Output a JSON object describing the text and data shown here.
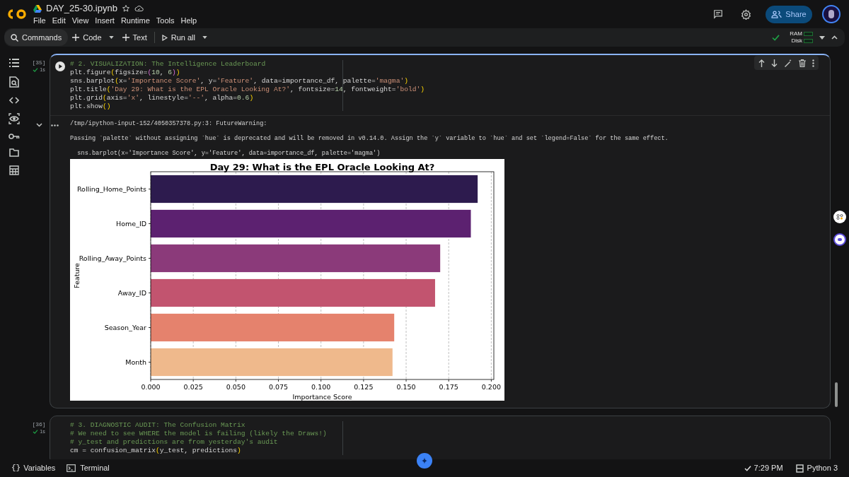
{
  "header": {
    "title": "DAY_25-30.ipynb",
    "menu": [
      "File",
      "Edit",
      "View",
      "Insert",
      "Runtime",
      "Tools",
      "Help"
    ],
    "share": "Share"
  },
  "toolbar": {
    "items": [
      {
        "kind": "search",
        "label": "Commands"
      },
      {
        "kind": "add",
        "label": "Code",
        "caret": true
      },
      {
        "kind": "add",
        "label": "Text",
        "caret": false
      },
      {
        "kind": "run",
        "label": "Run all",
        "caret": true
      }
    ],
    "ram": "RAM",
    "disk": "Disk"
  },
  "cells": [
    {
      "exec_count": "[35]",
      "duration": "1s",
      "focused": true,
      "code": [
        "# 2. VISUALIZATION: The Intelligence Leaderboard",
        "plt.figure(figsize=(10, 6))",
        "sns.barplot(x='Importance Score', y='Feature', data=importance_df, palette='magma')",
        "plt.title('Day 29: What is the EPL Oracle Looking At?', fontsize=14, fontweight='bold')",
        "plt.grid(axis='x', linestyle='--', alpha=0.6)",
        "plt.show()"
      ],
      "output": {
        "warning_path": "/tmp/ipython-input-152/4050357378.py:3: FutureWarning:",
        "warning": "Passing `palette` without assigning `hue` is deprecated and will be removed in v0.14.0. Assign the `y` variable to `hue` and set `legend=False` for the same effect.",
        "source_line": "  sns.barplot(x='Importance Score', y='Feature', data=importance_df, palette='magma')",
        "chart_data": {
          "type": "bar",
          "orientation": "horizontal",
          "title": "Day 29: What is the EPL Oracle Looking At?",
          "xlabel": "Importance Score",
          "ylabel": "Feature",
          "categories": [
            "Rolling_Home_Points",
            "Home_ID",
            "Rolling_Away_Points",
            "Away_ID",
            "Season_Year",
            "Month"
          ],
          "grid": true,
          "series": [
            {
              "colors": [
                "#2d1b4e",
                "#5c2170",
                "#8b3a7a",
                "#c2546f",
                "#e5826d",
                "#efb98c"
              ],
              "values": [
                0.192,
                0.188,
                0.17,
                0.167,
                0.143,
                0.142
              ]
            }
          ],
          "xlim": [
            0,
            0.2015
          ],
          "xticks": [
            {
              "value": 0,
              "label": "0.000"
            },
            {
              "value": 0.025,
              "label": "0.025"
            },
            {
              "value": 0.05,
              "label": "0.050"
            },
            {
              "value": 0.075,
              "label": "0.075"
            },
            {
              "value": 0.1,
              "label": "0.100"
            },
            {
              "value": 0.125,
              "label": "0.125"
            },
            {
              "value": 0.15,
              "label": "0.150"
            },
            {
              "value": 0.175,
              "label": "0.175"
            },
            {
              "value": 0.2,
              "label": "0.200"
            }
          ]
        }
      }
    },
    {
      "exec_count": "[36]",
      "duration": "1s",
      "focused": false,
      "code": [
        "# 3. DIAGNOSTIC AUDIT: The Confusion Matrix",
        "# We need to see WHERE the model is failing (likely the Draws!)",
        "# y_test and predictions are from yesterday's audit",
        "cm = confusion_matrix(y_test, predictions)"
      ]
    }
  ],
  "status_bar": {
    "variables_icon": "{}",
    "variables": "Variables",
    "terminal": "Terminal",
    "time": "7:29 PM",
    "runtime": "Python 3"
  }
}
